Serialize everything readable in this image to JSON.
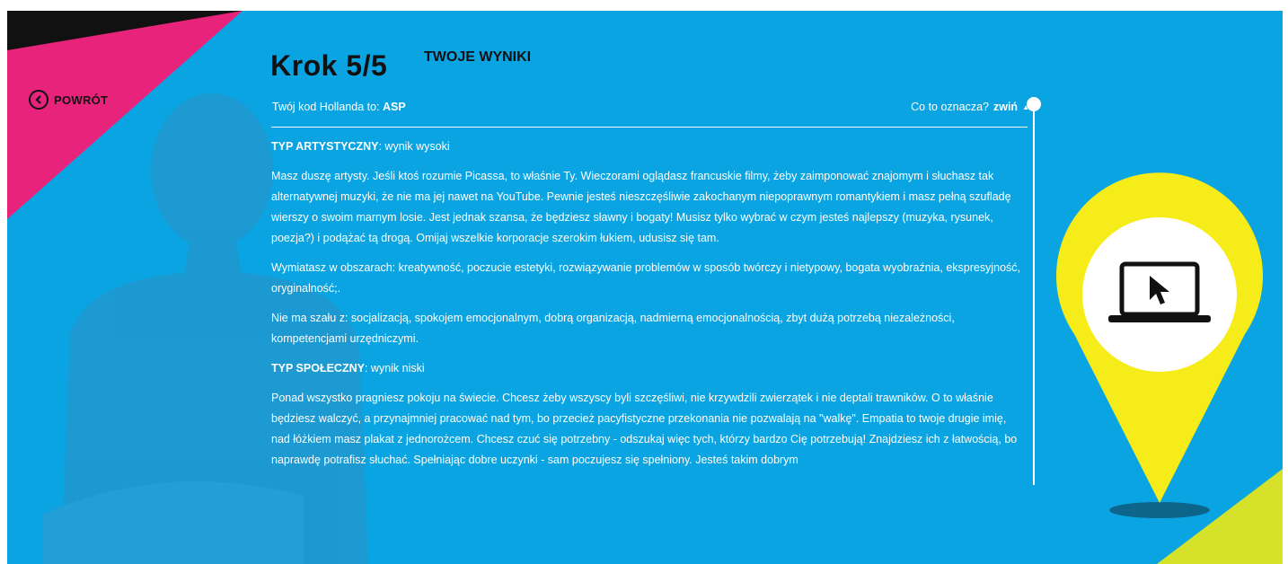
{
  "header": {
    "back_label": "POWRÓT",
    "step_title": "Krok 5/5",
    "step_subtitle": "TWOJE WYNIKI"
  },
  "result": {
    "code_prefix": "Twój kod Hollanda to: ",
    "code_value": "ASP",
    "meaning_question": "Co to oznacza?",
    "collapse_label": "zwiń",
    "collapse_arrow": "▲"
  },
  "sections": [
    {
      "type_name": "TYP ARTYSTYCZNY",
      "score_label": ": wynik wysoki",
      "description": "Masz duszę artysty. Jeśli ktoś rozumie Picassa, to właśnie Ty. Wieczorami oglądasz francuskie filmy, żeby zaimponować znajomym i słuchasz tak alternatywnej muzyki, że nie ma jej nawet na YouTube. Pewnie jesteś nieszczęśliwie zakochanym niepoprawnym romantykiem i masz pełną szufladę wierszy o swoim marnym losie. Jest jednak szansa, że będziesz sławny i bogaty! Musisz tylko wybrać w czym jesteś najlepszy (muzyka, rysunek, poezja?) i podążać tą drogą. Omijaj wszelkie korporacje szerokim łukiem, udusisz się tam.",
      "strengths": "Wymiatasz w obszarach: kreatywność, poczucie estetyki, rozwiązywanie problemów w sposób twórczy i nietypowy, bogata wyobraźnia, ekspresyjność, oryginalność;.",
      "weaknesses": "Nie ma szału z: socjalizacją, spokojem emocjonalnym, dobrą organizacją, nadmierną emocjonalnością, zbyt dużą potrzebą niezależności, kompetencjami urzędniczymi."
    },
    {
      "type_name": "TYP SPOŁECZNY",
      "score_label": ": wynik niski",
      "description": "Ponad wszystko pragniesz pokoju na świecie. Chcesz żeby wszyscy byli szczęśliwi, nie krzywdzili zwierzątek i nie deptali trawników. O to właśnie będziesz walczyć, a przynajmniej pracować nad tym, bo przecież pacyfistyczne przekonania nie pozwalają na \"walkę\". Empatia to twoje drugie imię, nad łóżkiem masz plakat z jednorożcem. Chcesz czuć się potrzebny - odszukaj więc tych, którzy bardzo Cię potrzebują! Znajdziesz ich z łatwością, bo naprawdę potrafisz słuchać. Spełniając dobre uczynki - sam poczujesz się spełniony. Jesteś takim dobrym"
    }
  ],
  "colors": {
    "background": "#0aa4e2",
    "accent_pink": "#e8237c",
    "pin_yellow": "#f5ec19",
    "corner_lime": "#d6e12a",
    "text": "#ffffff",
    "dark": "#111111"
  },
  "icons": {
    "back": "chevron-left-circle-icon",
    "scroll_handle": "scroll-thumb",
    "pin": "map-pin-icon",
    "laptop": "laptop-cursor-icon"
  }
}
